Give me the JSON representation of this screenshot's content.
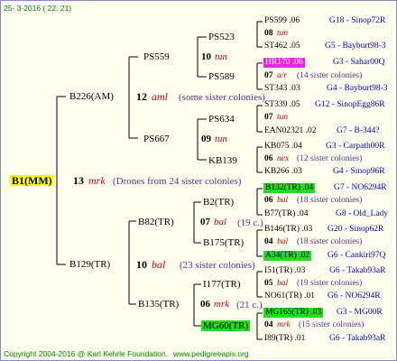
{
  "header": {
    "date": "25- 3-2016 ( 22: 21)"
  },
  "footer": {
    "copyright": "Copyright 2004-2016 @ Karl Kehrle Foundation.",
    "url": "www.pedigreeapis.org"
  },
  "colors": {
    "yellow": "#ffff00",
    "green": "#22dd22",
    "magenta": "#ee22ee",
    "red": "#cc0000",
    "blue": "#0000cc",
    "purple": "#5a2d8a",
    "line": "#000000"
  },
  "root": {
    "id": "B1(MM)",
    "num": "13",
    "code": "mrk",
    "note": "(Drones from 24 sister colonies)"
  },
  "gen1": [
    {
      "id": "B226(AM)",
      "num": "12",
      "code": "aml",
      "note": "(some sister colonies)"
    },
    {
      "id": "B129(TR)",
      "num": "10",
      "code": "bal",
      "note": "(23 sister colonies)"
    }
  ],
  "gen2": [
    {
      "id": "PS559",
      "num": "10",
      "code": "tun",
      "note": ""
    },
    {
      "id": "PS667",
      "num": "09",
      "code": "tun",
      "note": ""
    },
    {
      "id": "B82(TR)",
      "num": "07",
      "code": "bal",
      "note": "(19 c.)"
    },
    {
      "id": "B135(TR)",
      "num": "06",
      "code": "mrk",
      "note": "(21 c.)"
    }
  ],
  "gen3": [
    {
      "id": "PS523",
      "num": "08",
      "code": "tun",
      "note": ""
    },
    {
      "id": "PS589",
      "num": "07",
      "code": "a/r",
      "note": "(14 sister colonies)"
    },
    {
      "id": "PS634",
      "num": "07",
      "code": "tun",
      "note": ""
    },
    {
      "id": "KB139",
      "num": "06",
      "code": "nex",
      "note": "(12 sister colonies)"
    },
    {
      "id": "B2(TR)",
      "num": "06",
      "code": "bal",
      "note": "(18 sister colonies)"
    },
    {
      "id": "B175(TR)",
      "num": "04",
      "code": "bal",
      "note": "(18 sister colonies)"
    },
    {
      "id": "I177(TR)",
      "num": "05",
      "code": "bal",
      "note": "(19 sister colonies)"
    },
    {
      "id": "MG60(TR)",
      "num": "04",
      "code": "mrk",
      "note": "(15 sister colonies)"
    }
  ],
  "gen4": [
    {
      "id": "PS599 .06",
      "info": "G18 - Sinop72R"
    },
    {
      "id": "ST462 .05",
      "info": "G5 - Bayburt98-3"
    },
    {
      "id": "HR170 .06",
      "info": "G3 - Sahar00Q"
    },
    {
      "id": "ST343 .03",
      "info": "G4 - Bayburt98-3"
    },
    {
      "id": "ST339 .05",
      "info": "G12 - SinopEgg86R"
    },
    {
      "id": "EAN02321 .02",
      "info": "G7 - B-344?"
    },
    {
      "id": "KB075 .04",
      "info": "G3 - Carpath00R"
    },
    {
      "id": "KB266 .03",
      "info": "G4 - Sinop96R"
    },
    {
      "id": "B132(TR) .04",
      "info": "G7 - NO6294R"
    },
    {
      "id": "B77(TR) .04",
      "info": "G8 - Old_Lady"
    },
    {
      "id": "B146(TR) .03",
      "info": "G20 - Sinop62R"
    },
    {
      "id": "A34(TR) .02",
      "info": "G6 - Cankiri97Q"
    },
    {
      "id": "I51(TR) .03",
      "info": "G6 - Takab93aR"
    },
    {
      "id": "NO61(TR) .01",
      "info": "G6 - NO6294R"
    },
    {
      "id": "MG165(TR) .03",
      "info": "G3 - MG00R"
    },
    {
      "id": "I89(TR) .01",
      "info": "G6 - Takab93aR"
    }
  ]
}
